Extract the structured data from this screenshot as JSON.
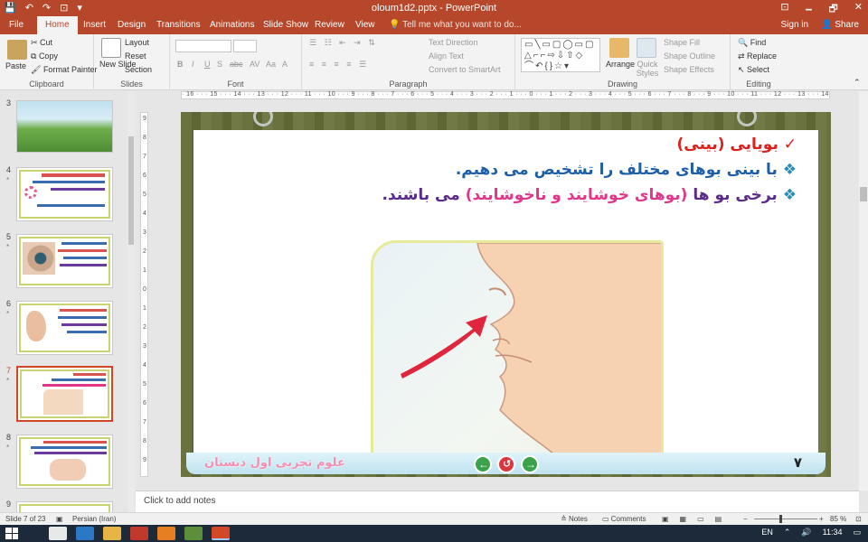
{
  "window": {
    "title": "oloum1d2.pptx - PowerPoint",
    "min_symbol": "🗕",
    "max_symbol": "🗗",
    "close_symbol": "✕",
    "ribbon_opt_symbol": "⊡"
  },
  "qat": {
    "save": "💾",
    "undo": "↶",
    "redo": "↷",
    "present": "⊡",
    "more": "▾"
  },
  "tabs": [
    "File",
    "Home",
    "Insert",
    "Design",
    "Transitions",
    "Animations",
    "Slide Show",
    "Review",
    "View"
  ],
  "tell_me": "Tell me what you want to do...",
  "account": {
    "sign_in": "Sign in",
    "share": "Share"
  },
  "ribbon": {
    "clipboard": {
      "label": "Clipboard",
      "paste": "Paste",
      "cut": "Cut",
      "copy": "Copy",
      "format_painter": "Format Painter"
    },
    "slides": {
      "label": "Slides",
      "new_slide": "New Slide",
      "layout": "Layout",
      "reset": "Reset",
      "section": "Section"
    },
    "font": {
      "label": "Font",
      "bold": "B",
      "italic": "I",
      "underline": "U",
      "shadow": "S",
      "strike": "abc",
      "spacing": "AV",
      "case": "Aa",
      "color": "A"
    },
    "paragraph": {
      "label": "Paragraph",
      "text_direction": "Text Direction",
      "align_text": "Align Text",
      "convert_smartart": "Convert to SmartArt"
    },
    "drawing": {
      "label": "Drawing",
      "arrange": "Arrange",
      "quick_styles": "Quick Styles",
      "shape_fill": "Shape Fill",
      "shape_outline": "Shape Outline",
      "shape_effects": "Shape Effects"
    },
    "editing": {
      "label": "Editing",
      "find": "Find",
      "replace": "Replace",
      "select": "Select"
    }
  },
  "ruler_text": "· 16 · · · 15 · · · 14 · · · 13 · · · 12 · · · 11 · · · 10 · · · 9 · · · 8 · · · 7 · · · 6 · · · 5 · · · 4 · · · 3 · · · 2 · · · 1 · · · 0 · · · 1 · · · 2 · · · 3 · · · 4 · · · 5 · · · 6 · · · 7 · · · 8 · · · 9 · · · 10 · · · 11 · · · 12 · · · 13 · · · 14 · · · 15 · · · 16 ·",
  "vruler_text": [
    "9",
    "8",
    "7",
    "6",
    "5",
    "4",
    "3",
    "2",
    "1",
    "0",
    "1",
    "2",
    "3",
    "4",
    "5",
    "6",
    "7",
    "8",
    "9"
  ],
  "thumbnails": [
    {
      "num": "3",
      "star": ""
    },
    {
      "num": "4",
      "star": "*"
    },
    {
      "num": "5",
      "star": "*"
    },
    {
      "num": "6",
      "star": "*"
    },
    {
      "num": "7",
      "star": "*"
    },
    {
      "num": "8",
      "star": "*"
    },
    {
      "num": "9",
      "star": ""
    }
  ],
  "slide": {
    "line1_check": "✓",
    "line1": "بویایی (بینی)",
    "line2_bullet": "❖",
    "line2": "با بینی بوهای مختلف را تشخیص می دهیم.",
    "line3_bullet": "❖",
    "line3_pre": "برخی بو ها ",
    "line3_colored": "(بوهای خوشایند و ناخوشایند)",
    "line3_post": " می باشند.",
    "footer": "علوم تجربی اول دبستان",
    "page_number": "۷"
  },
  "notes_placeholder": "Click to add notes",
  "status": {
    "slide_of": "Slide 7 of 23",
    "language": "Persian (Iran)",
    "notes": "Notes",
    "comments": "Comments",
    "zoom": "85 %",
    "minus": "−",
    "plus": "+"
  },
  "taskbar": {
    "lang": "EN",
    "time": "11:34"
  },
  "colors": {
    "accent": "#b7472a",
    "line1": "#e0201c",
    "line2": "#1e5fa8",
    "line3_text": "#5b2a8a",
    "line3_colored": "#e2368a"
  }
}
